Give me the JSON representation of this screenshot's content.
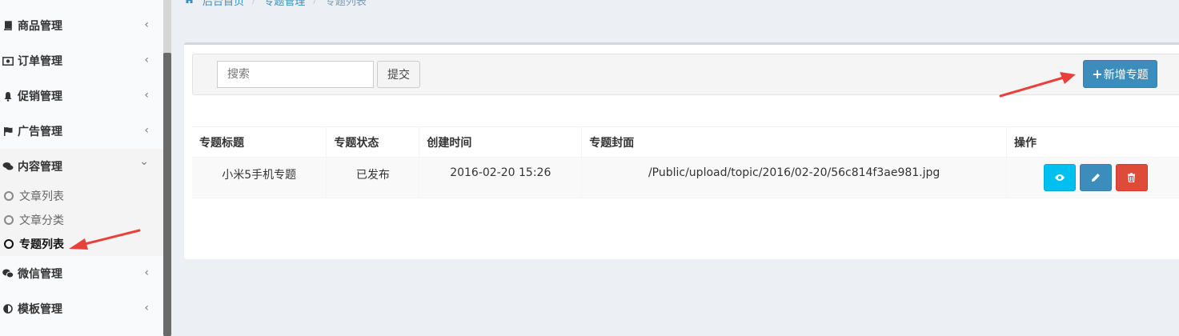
{
  "sidebar": {
    "items": [
      {
        "label": "商品管理",
        "icon": "book-icon",
        "chevron": "‹"
      },
      {
        "label": "订单管理",
        "icon": "money-icon",
        "chevron": "‹"
      },
      {
        "label": "促销管理",
        "icon": "bell-icon",
        "chevron": "‹"
      },
      {
        "label": "广告管理",
        "icon": "flag-icon",
        "chevron": "‹"
      },
      {
        "label": "内容管理",
        "icon": "comments-icon",
        "chevron": "⌄"
      },
      {
        "label": "微信管理",
        "icon": "wechat-icon",
        "chevron": "‹"
      },
      {
        "label": "模板管理",
        "icon": "adjust-icon",
        "chevron": "‹"
      }
    ],
    "submenu": [
      {
        "label": "文章列表"
      },
      {
        "label": "文章分类"
      },
      {
        "label": "专题列表"
      }
    ]
  },
  "breadcrumb": {
    "home": "后台首页",
    "section": "专题管理",
    "current": "专题列表"
  },
  "toolbar": {
    "search_placeholder": "搜索",
    "submit_label": "提交",
    "add_label": "新增专题"
  },
  "table": {
    "headers": [
      "专题标题",
      "专题状态",
      "创建时间",
      "专题封面",
      "操作"
    ],
    "rows": [
      {
        "title": "小米5手机专题",
        "status": "已发布",
        "created": "2016-02-20 15:26",
        "cover": "/Public/upload/topic/2016/02-20/56c814f3ae981.jpg"
      }
    ]
  },
  "colors": {
    "primary": "#3c8dbc",
    "info": "#00c0ef",
    "danger": "#dd4b39",
    "annotation_arrow": "#e8413c"
  }
}
